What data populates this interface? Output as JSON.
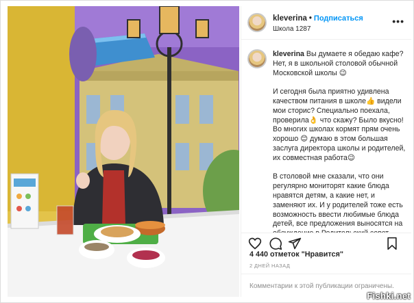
{
  "post": {
    "username": "kleverina",
    "separator": "•",
    "follow_label": "Подписаться",
    "location": "Школа 1287",
    "more_icon": "more-horizontal-icon"
  },
  "caption": {
    "username": "kleverina",
    "p1": "Вы думаете я обедаю кафе? Нет, я в школьной столовой обычной Московской школы 😉",
    "p2": "И сегодня была приятно удивлена качеством питания в школе👍 видели мои сторис? Специально поехала, проверила👌 что скажу? Было вкусно! Во многих школах кормят прям очень хорошо 😊 думаю в этом большая заслуга директора школы и родителей, их совместная работа😉",
    "p3": "В столовой мне сказали, что они регулярно мониторят какие блюда нравятся детям, а какие нет, и заменяют их. И у родителей тоже есть возможность ввести любимые блюда детей, все предложения выносятся на обсуждение в Родительский совет"
  },
  "actions": {
    "icons": [
      "heart-icon",
      "comment-icon",
      "share-icon",
      "bookmark-icon"
    ]
  },
  "likes_text": "4 440 отметок \"Нравится\"",
  "date_text": "2 ДНЕЙ НАЗАД",
  "comments_note": "Комментарии к этой публикации ограничены.",
  "watermark": "Fishki.net",
  "colors": {
    "follow": "#0095f6",
    "text": "#262626",
    "muted": "#8e8e8e",
    "border": "#efefef"
  }
}
